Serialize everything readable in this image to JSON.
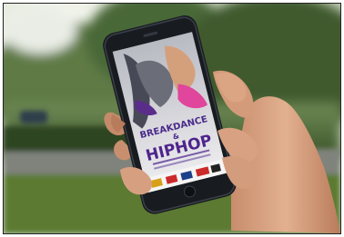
{
  "poster": {
    "line1": "BREAKDANCE",
    "line2": "&",
    "line3": "HIPHOP"
  },
  "sponsor_logos": [
    "logo-1",
    "logo-2",
    "logo-3",
    "logo-4"
  ],
  "colors": {
    "sky": "#eef0ec",
    "foliage": "#4f6b3a",
    "hedge": "#2f4a26",
    "path": "#8a8e86",
    "grass": "#5c7b34",
    "skin": "#d9a382",
    "skin_shadow": "#b77a5a",
    "phone_body": "#1c1f24",
    "screen_bg": "#c9c9cf",
    "poster_purple": "#5a2d8a",
    "poster_pink": "#e0469b",
    "poster_red": "#cc2a2a"
  }
}
